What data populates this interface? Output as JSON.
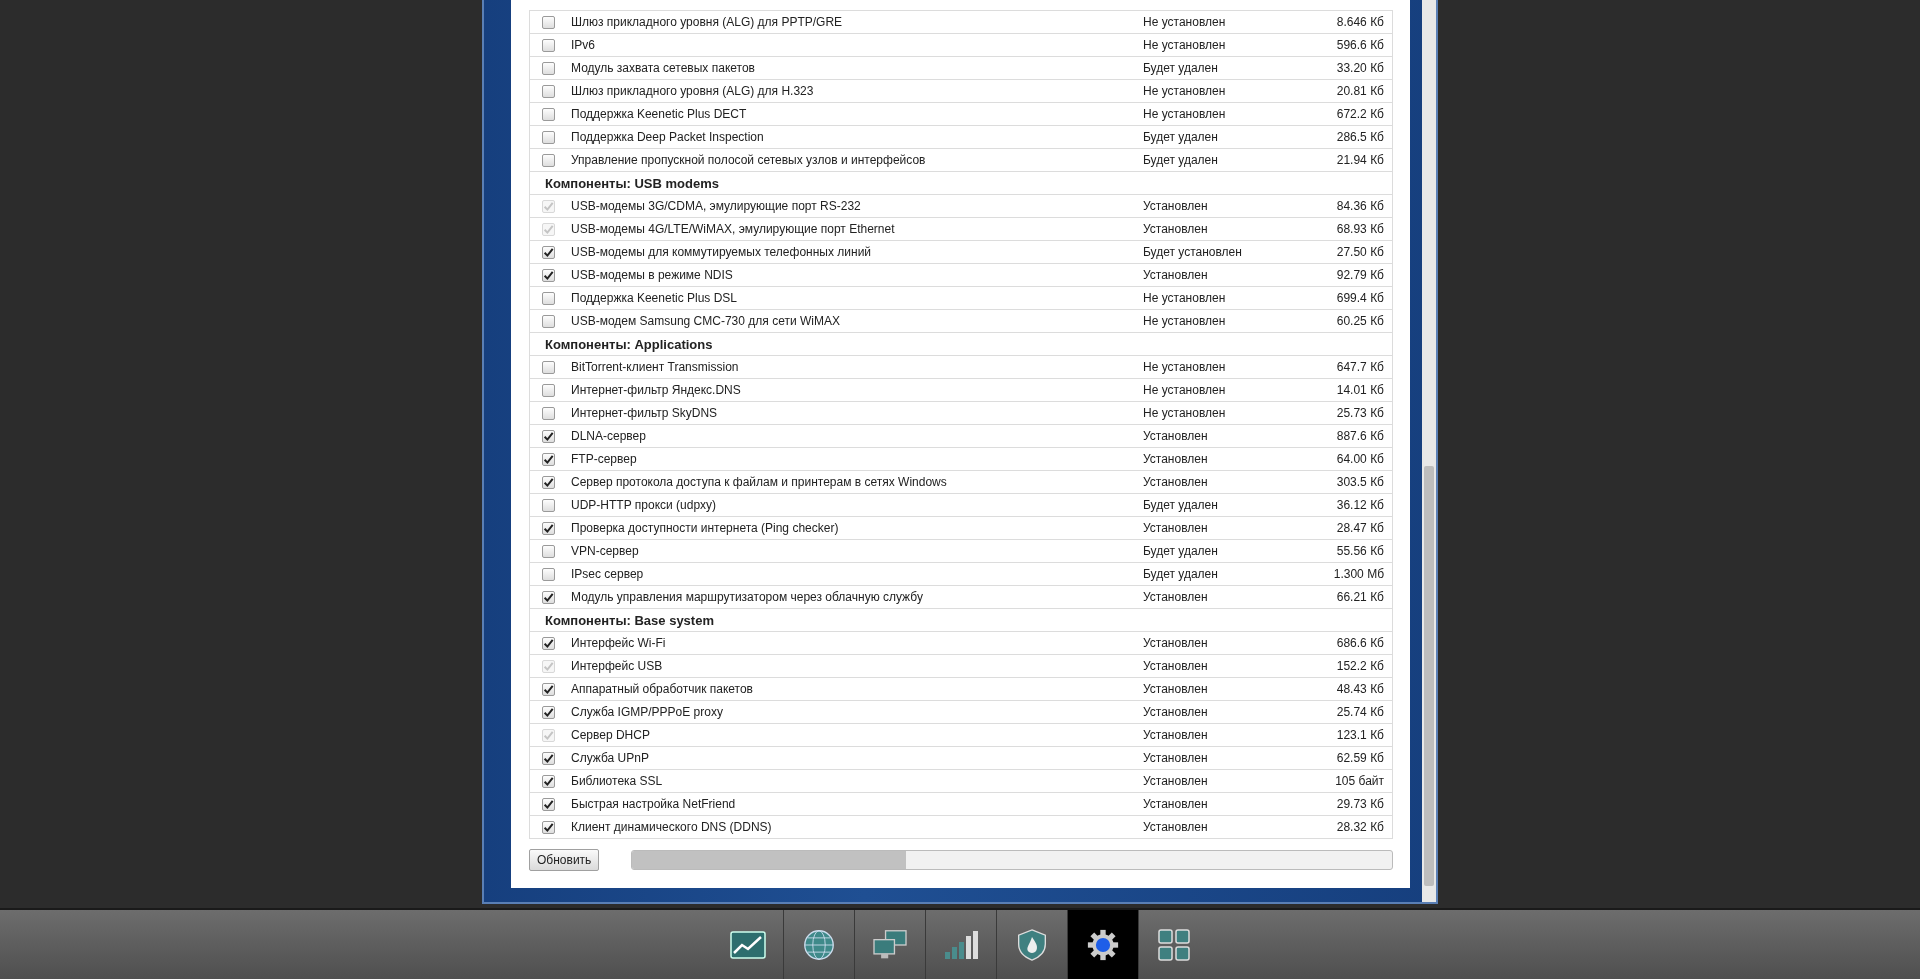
{
  "groups": [
    {
      "items": [
        {
          "name": "Шлюз прикладного уровня (ALG) для PPTP/GRE",
          "status": "Не установлен",
          "size": "8.646 Кб",
          "checked": false,
          "disabled": false
        },
        {
          "name": "IPv6",
          "status": "Не установлен",
          "size": "596.6 Кб",
          "checked": false,
          "disabled": false
        },
        {
          "name": "Модуль захвата сетевых пакетов",
          "status": "Будет удален",
          "size": "33.20 Кб",
          "checked": false,
          "disabled": false
        },
        {
          "name": "Шлюз прикладного уровня (ALG) для H.323",
          "status": "Не установлен",
          "size": "20.81 Кб",
          "checked": false,
          "disabled": false
        },
        {
          "name": "Поддержка Keenetic Plus DECT",
          "status": "Не установлен",
          "size": "672.2 Кб",
          "checked": false,
          "disabled": false
        },
        {
          "name": "Поддержка Deep Packet Inspection",
          "status": "Будет удален",
          "size": "286.5 Кб",
          "checked": false,
          "disabled": false
        },
        {
          "name": "Управление пропускной полосой сетевых узлов и интерфейсов",
          "status": "Будет удален",
          "size": "21.94 Кб",
          "checked": false,
          "disabled": false
        }
      ]
    },
    {
      "title": "Компоненты: USB modems",
      "items": [
        {
          "name": "USB-модемы 3G/CDMA, эмулирующие порт RS-232",
          "status": "Установлен",
          "size": "84.36 Кб",
          "checked": true,
          "disabled": true
        },
        {
          "name": "USB-модемы 4G/LTE/WiMAX, эмулирующие порт Ethernet",
          "status": "Установлен",
          "size": "68.93 Кб",
          "checked": true,
          "disabled": true
        },
        {
          "name": "USB-модемы для коммутируемых телефонных линий",
          "status": "Будет установлен",
          "size": "27.50 Кб",
          "checked": true,
          "disabled": false
        },
        {
          "name": "USB-модемы в режиме NDIS",
          "status": "Установлен",
          "size": "92.79 Кб",
          "checked": true,
          "disabled": false
        },
        {
          "name": "Поддержка Keenetic Plus DSL",
          "status": "Не установлен",
          "size": "699.4 Кб",
          "checked": false,
          "disabled": false
        },
        {
          "name": "USB-модем Samsung CMC-730 для сети WiMAX",
          "status": "Не установлен",
          "size": "60.25 Кб",
          "checked": false,
          "disabled": false
        }
      ]
    },
    {
      "title": "Компоненты: Applications",
      "items": [
        {
          "name": "BitTorrent-клиент Transmission",
          "status": "Не установлен",
          "size": "647.7 Кб",
          "checked": false,
          "disabled": false
        },
        {
          "name": "Интернет-фильтр Яндекс.DNS",
          "status": "Не установлен",
          "size": "14.01 Кб",
          "checked": false,
          "disabled": false
        },
        {
          "name": "Интернет-фильтр SkyDNS",
          "status": "Не установлен",
          "size": "25.73 Кб",
          "checked": false,
          "disabled": false
        },
        {
          "name": "DLNA-сервер",
          "status": "Установлен",
          "size": "887.6 Кб",
          "checked": true,
          "disabled": false
        },
        {
          "name": "FTP-сервер",
          "status": "Установлен",
          "size": "64.00 Кб",
          "checked": true,
          "disabled": false
        },
        {
          "name": "Сервер протокола доступа к файлам и принтерам в сетях Windows",
          "status": "Установлен",
          "size": "303.5 Кб",
          "checked": true,
          "disabled": false
        },
        {
          "name": "UDP-HTTP прокси (udpxy)",
          "status": "Будет удален",
          "size": "36.12 Кб",
          "checked": false,
          "disabled": false
        },
        {
          "name": "Проверка доступности интернета (Ping checker)",
          "status": "Установлен",
          "size": "28.47 Кб",
          "checked": true,
          "disabled": false
        },
        {
          "name": "VPN-сервер",
          "status": "Будет удален",
          "size": "55.56 Кб",
          "checked": false,
          "disabled": false
        },
        {
          "name": "IPsec сервер",
          "status": "Будет удален",
          "size": "1.300 Мб",
          "checked": false,
          "disabled": false
        },
        {
          "name": "Модуль управления маршрутизатором через облачную службу",
          "status": "Установлен",
          "size": "66.21 Кб",
          "checked": true,
          "disabled": false
        }
      ]
    },
    {
      "title": "Компоненты: Base system",
      "items": [
        {
          "name": "Интерфейс Wi-Fi",
          "status": "Установлен",
          "size": "686.6 Кб",
          "checked": true,
          "disabled": false
        },
        {
          "name": "Интерфейс USB",
          "status": "Установлен",
          "size": "152.2 Кб",
          "checked": true,
          "disabled": true
        },
        {
          "name": "Аппаратный обработчик пакетов",
          "status": "Установлен",
          "size": "48.43 Кб",
          "checked": true,
          "disabled": false
        },
        {
          "name": "Служба IGMP/PPPoE proxy",
          "status": "Установлен",
          "size": "25.74 Кб",
          "checked": true,
          "disabled": false
        },
        {
          "name": "Сервер DHCP",
          "status": "Установлен",
          "size": "123.1 Кб",
          "checked": true,
          "disabled": true
        },
        {
          "name": "Служба UPnP",
          "status": "Установлен",
          "size": "62.59 Кб",
          "checked": true,
          "disabled": false
        },
        {
          "name": "Библиотека SSL",
          "status": "Установлен",
          "size": "105 байт",
          "checked": true,
          "disabled": false
        },
        {
          "name": "Быстрая настройка NetFriend",
          "status": "Установлен",
          "size": "29.73 Кб",
          "checked": true,
          "disabled": false
        },
        {
          "name": "Клиент динамического DNS (DDNS)",
          "status": "Установлен",
          "size": "28.32 Кб",
          "checked": true,
          "disabled": false
        }
      ]
    }
  ],
  "update_button": "Обновить",
  "progress": {
    "level": 0.36
  },
  "taskbar": [
    {
      "kind": "chart",
      "selected": false
    },
    {
      "kind": "globe",
      "selected": false
    },
    {
      "kind": "computers",
      "selected": false
    },
    {
      "kind": "signal",
      "selected": false
    },
    {
      "kind": "shield",
      "selected": false
    },
    {
      "kind": "gear",
      "selected": true
    },
    {
      "kind": "grid",
      "selected": false
    }
  ]
}
